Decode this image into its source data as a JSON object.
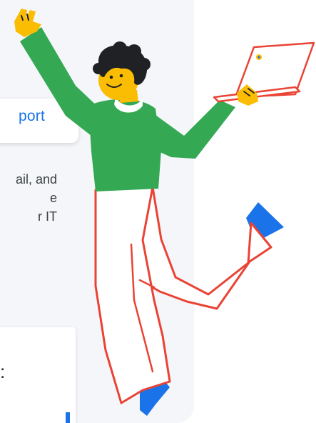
{
  "support_chip": {
    "label": "port"
  },
  "body_text": {
    "lines": [
      "ail, and",
      "e",
      "r IT"
    ]
  },
  "bottom_card": {
    "punct": ":"
  },
  "colors": {
    "accent_blue": "#1a73e8",
    "panel_bg": "#f4f6f9",
    "shirt_green": "#34a853",
    "outline_red": "#ea4335",
    "skin_yellow": "#fbbc04",
    "shoe_blue": "#1a73e8"
  },
  "illustration": {
    "icon": "person-jumping-with-laptop-illustration"
  }
}
